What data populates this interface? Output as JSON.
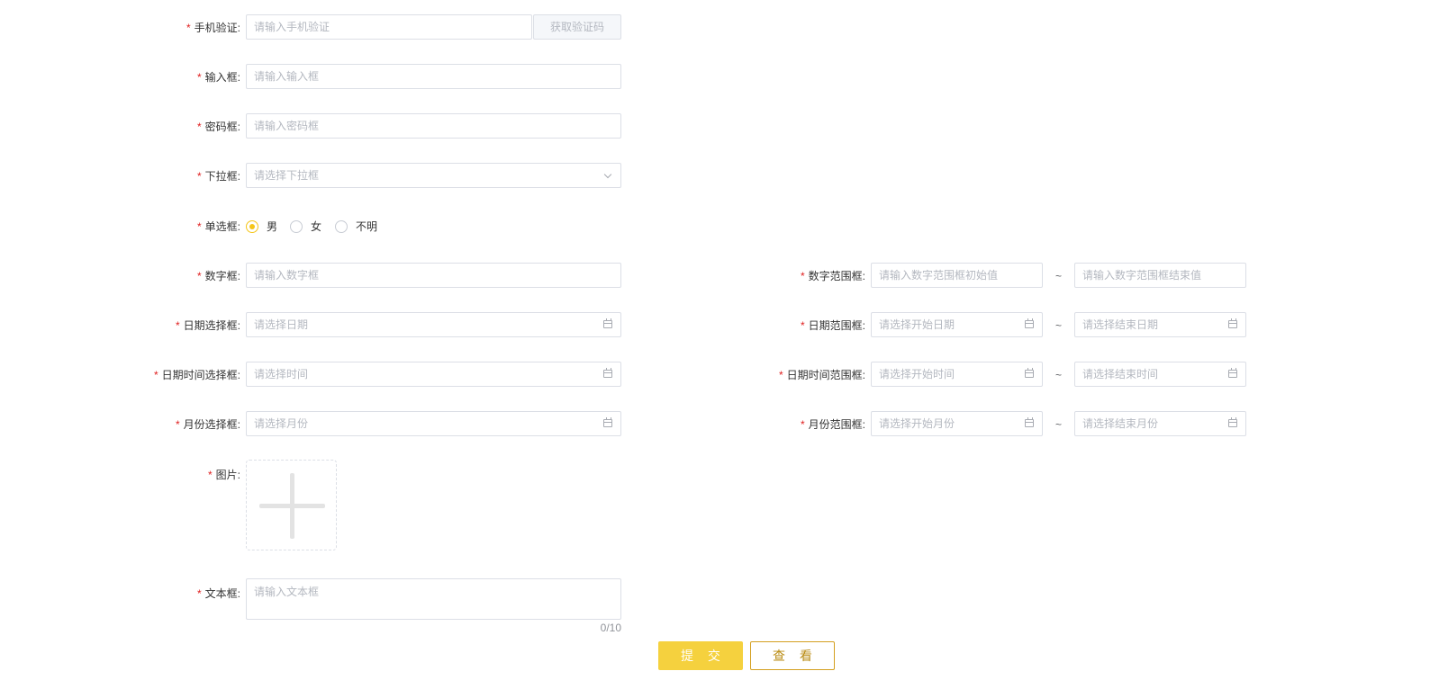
{
  "form": {
    "required_mark": "*",
    "phone_verify": {
      "label": "手机验证:",
      "placeholder": "请输入手机验证",
      "button": "获取验证码"
    },
    "input": {
      "label": "输入框:",
      "placeholder": "请输入输入框"
    },
    "password": {
      "label": "密码框:",
      "placeholder": "请输入密码框"
    },
    "select": {
      "label": "下拉框:",
      "placeholder": "请选择下拉框"
    },
    "radio": {
      "label": "单选框:",
      "options": [
        "男",
        "女",
        "不明"
      ],
      "selected": "男"
    },
    "number": {
      "label": "数字框:",
      "placeholder": "请输入数字框"
    },
    "number_range": {
      "label": "数字范围框:",
      "start_placeholder": "请输入数字范围框初始值",
      "end_placeholder": "请输入数字范围框结束值",
      "separator": "~"
    },
    "date": {
      "label": "日期选择框:",
      "placeholder": "请选择日期"
    },
    "date_range": {
      "label": "日期范围框:",
      "start_placeholder": "请选择开始日期",
      "end_placeholder": "请选择结束日期",
      "separator": "~"
    },
    "datetime": {
      "label": "日期时间选择框:",
      "placeholder": "请选择时间"
    },
    "datetime_range": {
      "label": "日期时间范围框:",
      "start_placeholder": "请选择开始时间",
      "end_placeholder": "请选择结束时间",
      "separator": "~"
    },
    "month": {
      "label": "月份选择框:",
      "placeholder": "请选择月份"
    },
    "month_range": {
      "label": "月份范围框:",
      "start_placeholder": "请选择开始月份",
      "end_placeholder": "请选择结束月份",
      "separator": "~"
    },
    "image": {
      "label": "图片:"
    },
    "textarea": {
      "label": "文本框:",
      "placeholder": "请输入文本框",
      "counter": "0/10"
    }
  },
  "actions": {
    "submit": "提 交",
    "view": "查 看"
  },
  "colors": {
    "accent": "#f5d13e",
    "accent_text": "#b88a10",
    "required": "#e02020",
    "border": "#dcdfe6",
    "placeholder": "#b4b8c0"
  },
  "icons": {
    "date_picker": "calendar-icon",
    "select": "chevron-down-icon",
    "upload": "plus-icon"
  }
}
